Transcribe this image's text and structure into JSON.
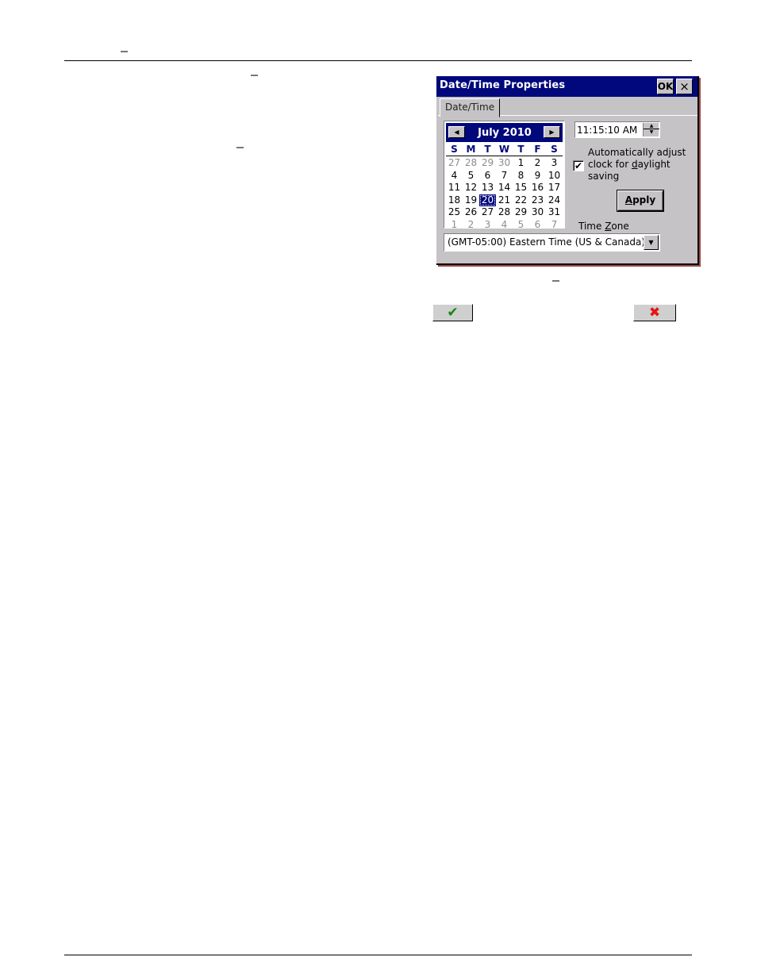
{
  "page": {
    "dashes": [
      "–",
      "–",
      "–",
      "–"
    ]
  },
  "dialog": {
    "title": "Date/Time Properties",
    "ok_label": "OK",
    "close_label": "×",
    "tab_label": "Date/Time",
    "calendar": {
      "month_label": "July 2010",
      "prev_icon": "◀",
      "next_icon": "▶",
      "weekdays": [
        "S",
        "M",
        "T",
        "W",
        "T",
        "F",
        "S"
      ],
      "weeks": [
        [
          {
            "d": "27",
            "o": true
          },
          {
            "d": "28",
            "o": true
          },
          {
            "d": "29",
            "o": true
          },
          {
            "d": "30",
            "o": true
          },
          {
            "d": "1"
          },
          {
            "d": "2"
          },
          {
            "d": "3"
          }
        ],
        [
          {
            "d": "4"
          },
          {
            "d": "5"
          },
          {
            "d": "6"
          },
          {
            "d": "7"
          },
          {
            "d": "8"
          },
          {
            "d": "9"
          },
          {
            "d": "10"
          }
        ],
        [
          {
            "d": "11"
          },
          {
            "d": "12"
          },
          {
            "d": "13"
          },
          {
            "d": "14"
          },
          {
            "d": "15"
          },
          {
            "d": "16"
          },
          {
            "d": "17"
          }
        ],
        [
          {
            "d": "18"
          },
          {
            "d": "19"
          },
          {
            "d": "20",
            "sel": true
          },
          {
            "d": "21"
          },
          {
            "d": "22"
          },
          {
            "d": "23"
          },
          {
            "d": "24"
          }
        ],
        [
          {
            "d": "25"
          },
          {
            "d": "26"
          },
          {
            "d": "27"
          },
          {
            "d": "28"
          },
          {
            "d": "29"
          },
          {
            "d": "30"
          },
          {
            "d": "31"
          }
        ],
        [
          {
            "d": "1",
            "o": true
          },
          {
            "d": "2",
            "o": true
          },
          {
            "d": "3",
            "o": true
          },
          {
            "d": "4",
            "o": true
          },
          {
            "d": "5",
            "o": true
          },
          {
            "d": "6",
            "o": true
          },
          {
            "d": "7",
            "o": true
          }
        ]
      ],
      "selected_day": "20"
    },
    "time_value": "11:15:10 AM",
    "spin_up": "▲",
    "spin_down": "▼",
    "auto_adjust_checked": true,
    "auto_adjust_check_glyph": "✔",
    "auto_adjust_label_1": "Automatically adjust",
    "auto_adjust_label_2a": "clock for ",
    "auto_adjust_label_2b": "d",
    "auto_adjust_label_2c": "aylight",
    "auto_adjust_label_3": "saving",
    "apply_a": "A",
    "apply_rest": "pply",
    "time_zone_label_a": "Time ",
    "time_zone_label_b": "Z",
    "time_zone_label_c": "one",
    "time_zone_value": "(GMT-05:00) Eastern Time (US & Canada)",
    "dropdown_icon": "▼"
  },
  "buttons": {
    "ok_icon": "✔",
    "cancel_icon": "✖"
  },
  "colors": {
    "titlebar": "#00087b",
    "dialog_bg": "#c6c3c6",
    "ok_green": "#118811",
    "cancel_red": "#e81414"
  }
}
